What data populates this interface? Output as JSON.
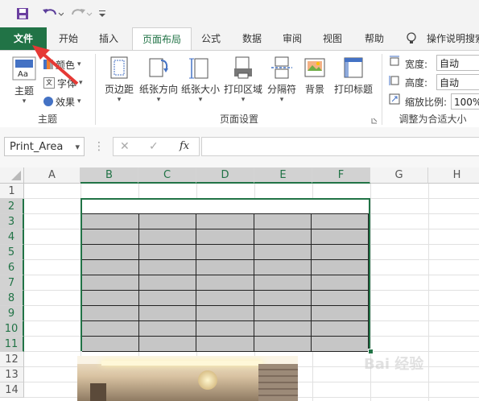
{
  "quick_access": {
    "save_icon": "save-icon",
    "undo_icon": "undo-icon",
    "redo_icon": "redo-icon",
    "customize_icon": "customize-qat-icon"
  },
  "tabs": [
    {
      "label": "文件",
      "kind": "file"
    },
    {
      "label": "开始"
    },
    {
      "label": "插入"
    },
    {
      "label": "页面布局",
      "active": true
    },
    {
      "label": "公式"
    },
    {
      "label": "数据"
    },
    {
      "label": "审阅"
    },
    {
      "label": "视图"
    },
    {
      "label": "帮助"
    }
  ],
  "tell_me": {
    "icon": "lightbulb-icon",
    "label": "操作说明搜索"
  },
  "ribbon": {
    "themes": {
      "group_label": "主题",
      "theme_button": "主题",
      "colors": "颜色",
      "fonts": "字体",
      "effects": "效果"
    },
    "page_setup": {
      "group_label": "页面设置",
      "margins": "页边距",
      "orientation": "纸张方向",
      "size": "纸张大小",
      "print_area": "打印区域",
      "breaks": "分隔符",
      "background": "背景",
      "print_titles": "打印标题"
    },
    "scale_to_fit": {
      "group_label": "调整为合适大小",
      "width_label": "宽度:",
      "width_value": "自动",
      "height_label": "高度:",
      "height_value": "自动",
      "scale_label": "缩放比例:",
      "scale_value": "100%"
    }
  },
  "formula_bar": {
    "name_box": "Print_Area",
    "fx_label": "fx",
    "formula_value": ""
  },
  "sheet": {
    "columns": [
      "A",
      "B",
      "C",
      "D",
      "E",
      "F",
      "G",
      "H"
    ],
    "selected_columns": [
      "B",
      "C",
      "D",
      "E",
      "F"
    ],
    "rows": [
      "1",
      "2",
      "3",
      "4",
      "5",
      "6",
      "7",
      "8",
      "9",
      "10",
      "11",
      "12",
      "13",
      "14"
    ],
    "selected_rows": [
      "2",
      "3",
      "4",
      "5",
      "6",
      "7",
      "8",
      "9",
      "10",
      "11"
    ],
    "table_fill_color": "#c6c6c6",
    "selection_color": "#217346"
  },
  "watermark": {
    "text": "Bai 经验"
  },
  "colors": {
    "accent": "#217346",
    "arrow": "#e53935"
  }
}
